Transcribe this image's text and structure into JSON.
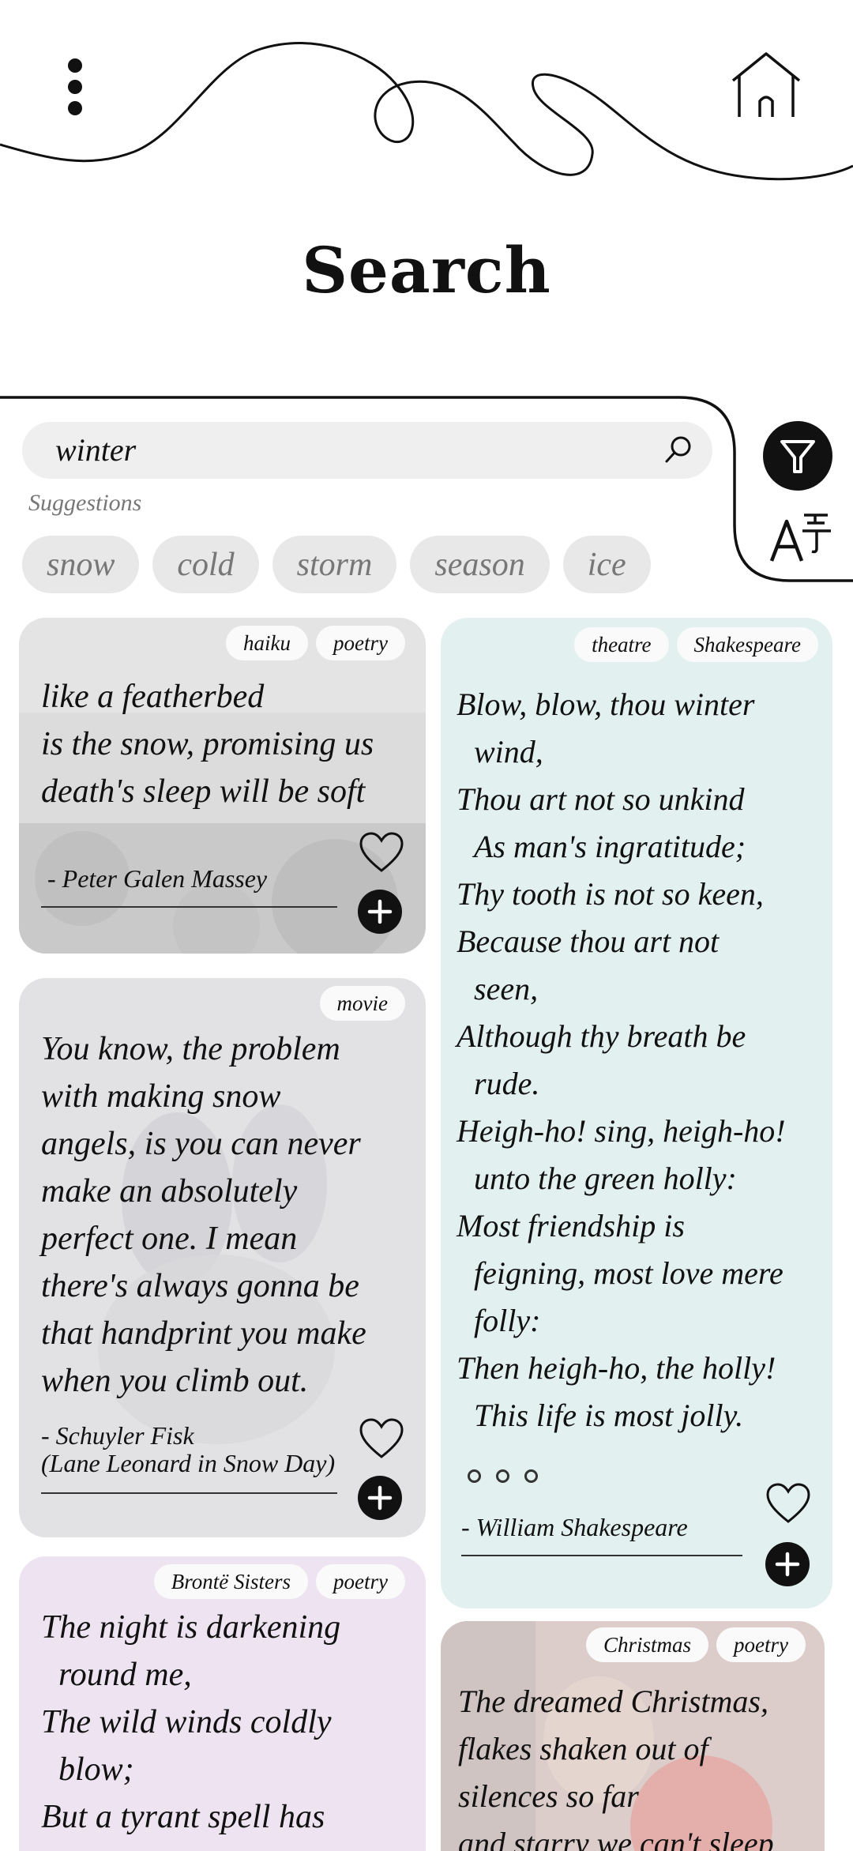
{
  "header": {
    "title": "Search",
    "menu_icon": "kebab-menu-icon",
    "home_icon": "home-icon"
  },
  "search": {
    "value": "winter",
    "icon": "search-icon",
    "suggestions_label": "Suggestions",
    "suggestions": [
      "snow",
      "cold",
      "storm",
      "season",
      "ice"
    ]
  },
  "side_controls": {
    "filter_icon": "filter-funnel-icon",
    "translate_icon": "translate-icon"
  },
  "cards": [
    {
      "tags": [
        "haiku",
        "poetry"
      ],
      "lines": [
        "like a featherbed",
        "is the snow, promising us",
        "death's sleep will be soft"
      ],
      "author": [
        "- Peter Galen Massey"
      ]
    },
    {
      "tags": [
        "movie"
      ],
      "lines": [
        "You know, the problem",
        "with making snow",
        "angels, is you can never",
        "make an absolutely",
        "perfect one. I mean",
        "there's always gonna be",
        "that handprint you make",
        "when you climb out."
      ],
      "author": [
        "- Schuyler Fisk",
        "(Lane Leonard in Snow Day)"
      ]
    },
    {
      "tags": [
        "Brontë Sisters",
        "poetry"
      ],
      "lines": [
        "The night is darkening",
        "round me,",
        "The wild winds coldly",
        "blow;",
        "But a tyrant spell has"
      ]
    },
    {
      "tags": [
        "theatre",
        "Shakespeare"
      ],
      "lines": [
        "Blow, blow, thou winter",
        "wind,",
        "Thou art not so unkind",
        "As man's ingratitude;",
        "Thy tooth is not so keen,",
        "Because thou art not",
        "seen,",
        "Although thy breath be",
        "rude.",
        "Heigh-ho! sing, heigh-ho!",
        "unto the green holly:",
        "Most friendship is",
        "feigning, most love mere",
        "folly:",
        "Then heigh-ho, the holly!",
        "This life is most jolly."
      ],
      "author": [
        "- William Shakespeare"
      ]
    },
    {
      "tags": [
        "Christmas",
        "poetry"
      ],
      "lines": [
        "The dreamed Christmas,",
        "flakes shaken out of",
        "silences so far",
        "and starry we can't sleep"
      ]
    }
  ],
  "colors": {
    "card_snow": "#dcdcdc",
    "card_movie": "#e2e2e4",
    "card_bronte": "#eee3f1",
    "card_shakespeare": "#e2f1ef",
    "card_christmas": "#dccdcb",
    "chip_bg": "#e8e8e8",
    "search_bg": "#efefef"
  }
}
